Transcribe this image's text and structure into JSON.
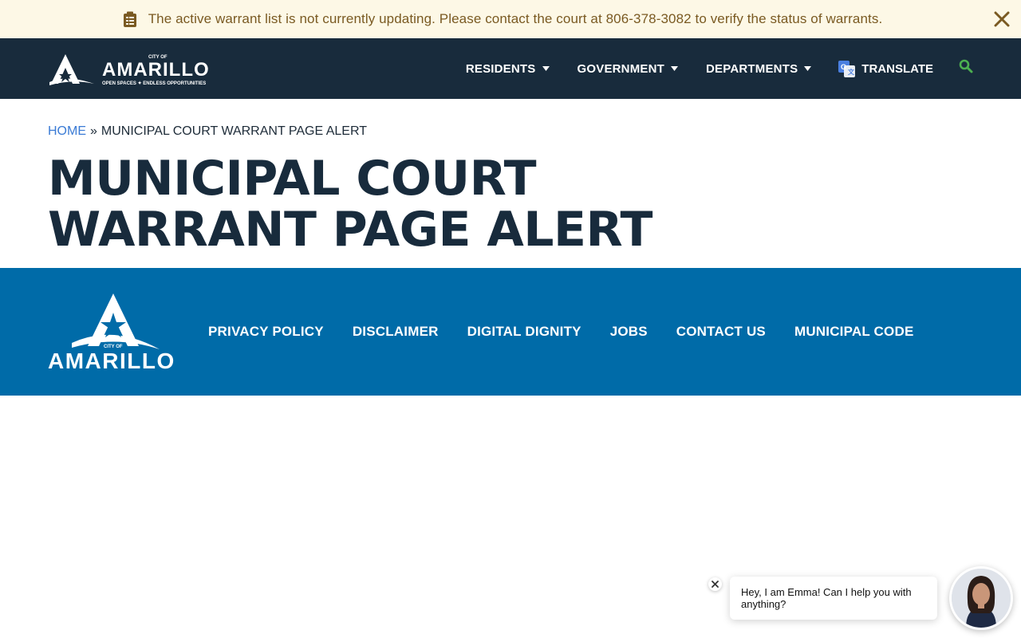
{
  "alert": {
    "message": "The active warrant list is not currently updating. Please contact the court at 806-378-3082 to verify the status of warrants.",
    "icon": "clipboard-icon",
    "close_icon": "close-icon",
    "text_color": "#7a5a22",
    "bg_color": "#fdf8e6"
  },
  "header": {
    "logo": {
      "city_of": "CITY OF",
      "name": "AMARILLO",
      "tagline": "OPEN SPACES ✦ ENDLESS OPPORTUNITIES"
    },
    "nav": [
      {
        "label": "RESIDENTS"
      },
      {
        "label": "GOVERNMENT"
      },
      {
        "label": "DEPARTMENTS"
      }
    ],
    "translate_label": "TRANSLATE",
    "search_icon": "search-icon",
    "bg_color": "#182b3c",
    "accent_color": "#4caf50"
  },
  "breadcrumb": {
    "home": "HOME",
    "separator": "»",
    "current": "MUNICIPAL COURT WARRANT PAGE ALERT"
  },
  "page": {
    "title_line1": "MUNICIPAL COURT",
    "title_line2": "WARRANT PAGE ALERT"
  },
  "footer": {
    "logo": {
      "city_of": "CITY OF",
      "name": "AMARILLO"
    },
    "links": [
      {
        "label": "PRIVACY POLICY"
      },
      {
        "label": "DISCLAIMER"
      },
      {
        "label": "DIGITAL DIGNITY"
      },
      {
        "label": "JOBS"
      },
      {
        "label": "CONTACT US"
      },
      {
        "label": "MUNICIPAL CODE"
      }
    ],
    "bg_color": "#006ba8"
  },
  "chat": {
    "message": "Hey, I am Emma! Can I help you with anything?",
    "close_icon": "close-icon"
  }
}
